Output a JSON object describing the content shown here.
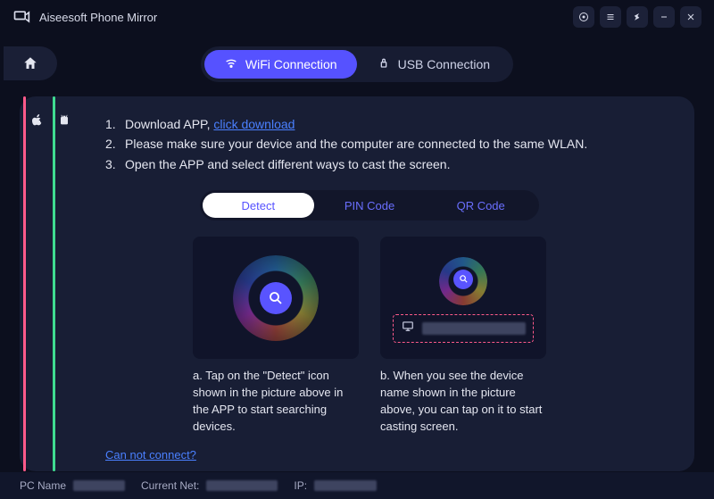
{
  "titlebar": {
    "title": "Aiseesoft Phone Mirror"
  },
  "connection_tabs": {
    "wifi": "WiFi Connection",
    "usb": "USB Connection"
  },
  "instructions": {
    "line1_prefix": "Download APP, ",
    "line1_link": "click download",
    "line2": "Please make sure your device and the computer are connected to the same WLAN.",
    "line3": "Open the APP and select different ways to cast the screen."
  },
  "mode_tabs": {
    "detect": "Detect",
    "pin": "PIN Code",
    "qr": "QR Code"
  },
  "cards": {
    "a": "a. Tap on the \"Detect\" icon shown in the picture above in the APP to start searching devices.",
    "b": "b. When you see the device name shown in the picture above, you can tap on it to start casting screen."
  },
  "cannot_connect": "Can not connect?",
  "statusbar": {
    "pc_label": "PC Name",
    "net_label": "Current Net:",
    "ip_label": "IP:"
  }
}
